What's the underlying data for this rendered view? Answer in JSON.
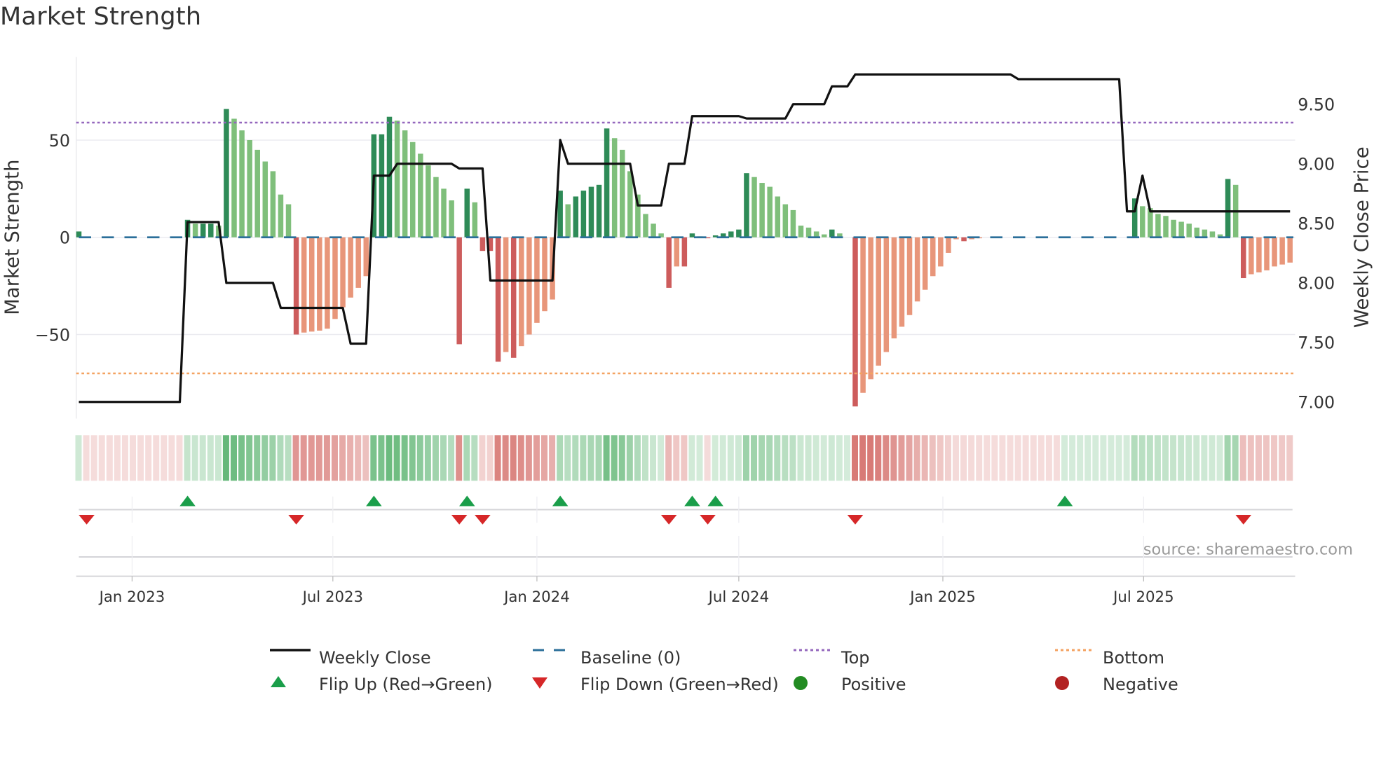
{
  "title": "Market Strength",
  "source": "source: sharemaestro.com",
  "colors": {
    "line": "#111111",
    "baseline": "#2b6f9a",
    "top": "#9467bd",
    "bottom": "#f4a261",
    "pos_strong": "#2e8b57",
    "pos_weak": "#7fbf7b",
    "neg_strong": "#cd5c5c",
    "neg_weak": "#e8967a",
    "flip_up": "#1a9e4a",
    "flip_down": "#d62728",
    "positive": "#228b22",
    "negative": "#b22222",
    "grid": "#ebebf0"
  },
  "legend": [
    {
      "key": "weekly_close",
      "label": "Weekly Close"
    },
    {
      "key": "baseline",
      "label": "Baseline (0)"
    },
    {
      "key": "top",
      "label": "Top"
    },
    {
      "key": "bottom",
      "label": "Bottom"
    },
    {
      "key": "flip_up",
      "label": "Flip Up (Red→Green)"
    },
    {
      "key": "flip_down",
      "label": "Flip Down (Green→Red)"
    },
    {
      "key": "positive",
      "label": "Positive"
    },
    {
      "key": "negative",
      "label": "Negative"
    }
  ],
  "chart_data": {
    "type": "bar",
    "title": "Market Strength",
    "ylabel": "Market Strength",
    "y2label": "Weekly Close Price",
    "frequency": "weekly",
    "week_start": "2022-11-14",
    "ylim": [
      -94,
      93
    ],
    "y2lim": [
      6.86,
      9.97
    ],
    "yticks": [
      {
        "v": 50,
        "label": "50"
      },
      {
        "v": 0,
        "label": "0"
      },
      {
        "v": -50,
        "label": "−50"
      }
    ],
    "y2ticks": [
      {
        "v": 9.5,
        "label": "9.50"
      },
      {
        "v": 9.0,
        "label": "9.00"
      },
      {
        "v": 8.5,
        "label": "8.50"
      },
      {
        "v": 8.0,
        "label": "8.00"
      },
      {
        "v": 7.5,
        "label": "7.50"
      },
      {
        "v": 7.0,
        "label": "7.00"
      }
    ],
    "xticks": [
      {
        "date": "2023-01-01",
        "label": "Jan 2023"
      },
      {
        "date": "2023-07-01",
        "label": "Jul 2023"
      },
      {
        "date": "2024-01-01",
        "label": "Jan 2024"
      },
      {
        "date": "2024-07-01",
        "label": "Jul 2024"
      },
      {
        "date": "2025-01-01",
        "label": "Jan 2025"
      },
      {
        "date": "2025-07-01",
        "label": "Jul 2025"
      }
    ],
    "top_level": 59,
    "bottom_level": -70,
    "baseline": 0,
    "strength": [
      3,
      0,
      0,
      0,
      0,
      0,
      0,
      0,
      0,
      0,
      0,
      0,
      0,
      0,
      9,
      7,
      7,
      7,
      6,
      66,
      61,
      55,
      50,
      45,
      39,
      34,
      22,
      17,
      -50,
      -49,
      -48.5,
      -48,
      -47,
      -42,
      -36,
      -31,
      -26,
      -20,
      53,
      53,
      62,
      60,
      55,
      49,
      43,
      37,
      31,
      25,
      19,
      -55,
      25,
      18,
      -7,
      -7,
      -64,
      -59,
      -62,
      -56,
      -50,
      -44,
      -38,
      -32,
      24,
      17,
      21,
      24,
      26,
      27,
      56,
      51,
      45,
      34,
      22,
      12,
      7,
      2,
      -26,
      -15,
      -15,
      2,
      0.5,
      -0.5,
      1,
      2,
      3,
      4,
      33,
      31,
      28,
      26,
      21,
      17,
      14,
      6,
      5,
      3,
      1.5,
      4,
      2,
      0,
      -87,
      -80,
      -73,
      -66,
      -59,
      -52,
      -46,
      -40,
      -33,
      -27,
      -20,
      -15,
      -8,
      -1,
      -2,
      -1,
      -0.5,
      0,
      0,
      0,
      0,
      0,
      0,
      0,
      0,
      0,
      0,
      0,
      0,
      0,
      0,
      0,
      0,
      0,
      0,
      0,
      20,
      16,
      15,
      12,
      11,
      9,
      8,
      7,
      5,
      4,
      3,
      1.5,
      30,
      27,
      -21,
      -19,
      -18,
      -17,
      -15,
      -14,
      -13
    ],
    "weekly_close": [
      7.0,
      7.0,
      7.0,
      7.0,
      7.0,
      7.0,
      7.0,
      7.0,
      7.0,
      7.0,
      7.0,
      7.0,
      7.0,
      7.0,
      8.51,
      8.51,
      8.51,
      8.51,
      8.51,
      8.0,
      8.0,
      8.0,
      8.0,
      8.0,
      8.0,
      8.0,
      7.79,
      7.79,
      7.79,
      7.79,
      7.79,
      7.79,
      7.79,
      7.79,
      7.79,
      7.49,
      7.49,
      7.49,
      8.9,
      8.9,
      8.9,
      9.0,
      9.0,
      9.0,
      9.0,
      9.0,
      9.0,
      9.0,
      9.0,
      8.96,
      8.96,
      8.96,
      8.96,
      8.02,
      8.02,
      8.02,
      8.02,
      8.02,
      8.02,
      8.02,
      8.02,
      8.02,
      9.2,
      9.0,
      9.0,
      9.0,
      9.0,
      9.0,
      9.0,
      9.0,
      9.0,
      9.0,
      8.65,
      8.65,
      8.65,
      8.65,
      9.0,
      9.0,
      9.0,
      9.4,
      9.4,
      9.4,
      9.4,
      9.4,
      9.4,
      9.4,
      9.38,
      9.38,
      9.38,
      9.38,
      9.38,
      9.38,
      9.5,
      9.5,
      9.5,
      9.5,
      9.5,
      9.65,
      9.65,
      9.65,
      9.75,
      9.75,
      9.75,
      9.75,
      9.75,
      9.75,
      9.75,
      9.75,
      9.75,
      9.75,
      9.75,
      9.75,
      9.75,
      9.75,
      9.75,
      9.75,
      9.75,
      9.75,
      9.75,
      9.75,
      9.75,
      9.71,
      9.71,
      9.71,
      9.71,
      9.71,
      9.71,
      9.71,
      9.71,
      9.71,
      9.71,
      9.71,
      9.71,
      9.71,
      9.71,
      8.6,
      8.6,
      8.9,
      8.6,
      8.6,
      8.6,
      8.6,
      8.6,
      8.6,
      8.6,
      8.6,
      8.6,
      8.6,
      8.6,
      8.6,
      8.6,
      8.6,
      8.6,
      8.6,
      8.6,
      8.6,
      8.6
    ],
    "flip_up_weeks": [
      14,
      38,
      50,
      62,
      79,
      82,
      127
    ],
    "flip_down_weeks": [
      1,
      28,
      49,
      52,
      76,
      81,
      100,
      150
    ],
    "initial_regime": "positive",
    "grid": true,
    "legend_position": "bottom"
  }
}
